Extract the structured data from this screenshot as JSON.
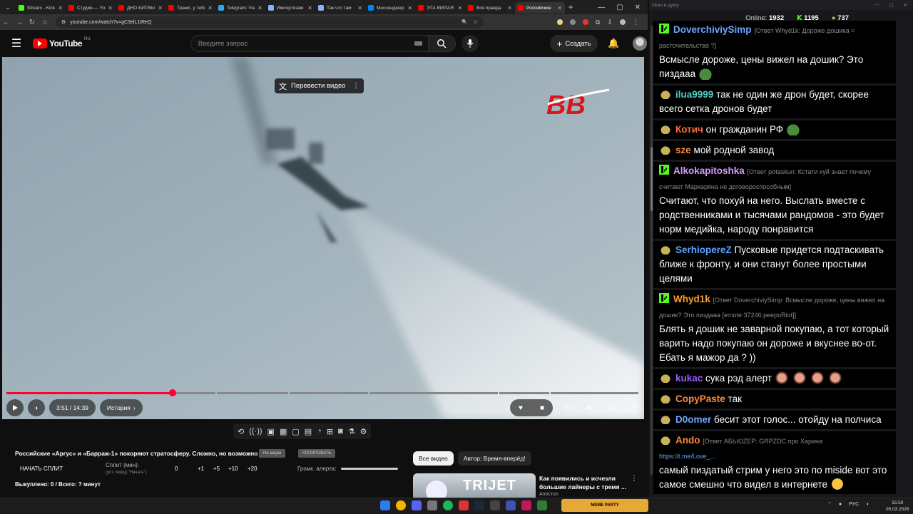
{
  "browser": {
    "tabs": [
      {
        "title": "Stream - Kick",
        "color": "#53fc18"
      },
      {
        "title": "Студия — YouTube",
        "color": "#ff0000"
      },
      {
        "title": "ДНО БИТВЫ",
        "color": "#ff0000"
      },
      {
        "title": "Трамп, у тебя",
        "color": "#ff0000"
      },
      {
        "title": "Telegram: View",
        "color": "#2aabee"
      },
      {
        "title": "Импортозам",
        "color": "#8ab4f8"
      },
      {
        "title": "Так что там",
        "color": "#8ab4f8"
      },
      {
        "title": "Мессенджер",
        "color": "#0084ff"
      },
      {
        "title": "ЭТА МИЛАЯ",
        "color": "#ff0000"
      },
      {
        "title": "Вся правда",
        "color": "#ff0000"
      },
      {
        "title": "Российские",
        "color": "#ff0000"
      }
    ],
    "url": "youtube.com/watch?v=gC3elL1tReQ"
  },
  "youtube": {
    "logo_text": "YouTube",
    "country": "RU",
    "search_placeholder": "Введите запрос",
    "create_label": "Создать"
  },
  "player": {
    "translate_label": "Перевести видео",
    "time": "3:51 / 14:39",
    "chapter_label": "История",
    "progress_fraction": 0.263,
    "channel_logo": "BB"
  },
  "video": {
    "title": "Российские «Аргус» и «Барраж-1» покоряют стратосферу. Сложно, но возможно",
    "badge1": "На акции",
    "badge2": "КОПИРОВАТЬ"
  },
  "split": {
    "start_label": "НАЧАТЬ СПЛИТ",
    "minutes_label": "Сплит (мин):",
    "minutes_hint": "(уст. перед \"Начать\")",
    "values": [
      "0",
      "+1",
      "+5",
      "+10",
      "+20"
    ],
    "alert_label": "Громк. алерта:",
    "bought_label": "Выкуплено: 0 / Всего: ? минут"
  },
  "related": {
    "chips": [
      "Все видео",
      "Автор: Время-вперёд!"
    ],
    "thumb_text": "TRIJET",
    "title": "Как появились и исчезли большие лайнеры с тремя ...",
    "channel": "Апостол"
  },
  "chat": {
    "window_title": "Окно в душу",
    "online_label": "Online:",
    "online_count": "1932",
    "kick_count": "1195",
    "points_count": "737",
    "messages": [
      {
        "user": "DoverchiviySimp",
        "color": "#6ea8ff",
        "badge": "kick",
        "reply": "[Ответ Whyd1k: Дороже дошика = расточительство ?]",
        "text": "Всмысле дороже, цены вижел на дошик? Это пиздааа",
        "emote": "frog"
      },
      {
        "user": "ilua9999",
        "color": "#4fd1c5",
        "badge": "frog",
        "reply": "",
        "text": "так не один же дрон будет, скорее всего сетка дронов будет",
        "emote": ""
      },
      {
        "user": "Котич",
        "color": "#ff6b3d",
        "badge": "frog",
        "reply": "",
        "text": "он гражданин РФ",
        "emote": "frog"
      },
      {
        "user": "sze",
        "color": "#ff8a3d",
        "badge": "frog",
        "reply": "",
        "text": "мой родной завод",
        "emote": ""
      },
      {
        "user": "Alkokapitoshka",
        "color": "#d59bff",
        "badge": "kick",
        "reply": "[Ответ potaskun: Кстати хуй знает почему считают Маркаряна не договороспособным]",
        "text": "Считают, что похуй на него. Выслать вместе с родственниками и тысячами рандомов - это будет норм медийка, народу понравится",
        "emote": ""
      },
      {
        "user": "SerhiopereZ",
        "color": "#5aa8ff",
        "badge": "frog",
        "reply": "",
        "text": "Пусковые придется подтаскивать ближе к фронту, и они станут более простыми целями",
        "emote": ""
      },
      {
        "user": "Whyd1k",
        "color": "#ff9d2e",
        "badge": "kick",
        "reply": "[Ответ DoverchiviySimp: Всмысле дороже, цены вижел на дошик? Это пиздааа [emote:37246:peepoRiot]]",
        "text": "Блять я дошик не заварной покупаю, а тот который варить надо покупаю он дороже и вкуснее во-от. Ебать я мажор да ? ))",
        "emote": ""
      },
      {
        "user": "kukac",
        "color": "#9b5cff",
        "badge": "frog",
        "reply": "",
        "text": "сука рэд алерт",
        "emote": "faces"
      },
      {
        "user": "CopyPaste",
        "color": "#ff8a3d",
        "badge": "frog",
        "reply": "",
        "text": "так",
        "emote": ""
      },
      {
        "user": "D0omer",
        "color": "#6ea8ff",
        "badge": "frog",
        "reply": "",
        "text": "бесит этот голос... отойду на полчиса",
        "emote": ""
      },
      {
        "user": "Ando",
        "color": "#ff8a3d",
        "badge": "frog",
        "reply": "[Ответ АБЬЮZЕР: GRPZDC про Харина",
        "link": "https://t.me/Love_...",
        "text": "самый пиздатый стрим у него это по miside вот это самое смешно что видел в интернете",
        "emote": "laugh"
      }
    ]
  },
  "taskbar": {
    "widget_text": "MEME PARTY",
    "lang": "РУС",
    "time": "15:50",
    "date": "05.03.2026"
  }
}
